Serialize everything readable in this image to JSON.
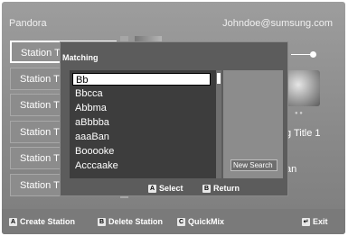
{
  "header": {
    "app_title": "Pandora",
    "account": "Johndoe@sumsung.com"
  },
  "stations": [
    {
      "label": "Station Title"
    },
    {
      "label": "Station Title"
    },
    {
      "label": "Station Title"
    },
    {
      "label": "Station Title"
    },
    {
      "label": "Station Title"
    },
    {
      "label": "Station Title"
    }
  ],
  "now_playing": {
    "song_title": "g Title 1",
    "artist": "an"
  },
  "popup": {
    "title": "Matching",
    "items": [
      "Bb",
      "Bbcca",
      "Abbma",
      "aBbbba",
      "aaaBan",
      "Booooke",
      "Acccaake"
    ],
    "selected_index": 0,
    "new_search_label": "New Search",
    "hints": {
      "select_key": "A",
      "select_label": "Select",
      "return_key": "B",
      "return_label": "Return"
    }
  },
  "bottom_bar": {
    "create": {
      "key": "A",
      "label": "Create Station"
    },
    "delete": {
      "key": "B",
      "label": "Delete Station"
    },
    "quickmix": {
      "key": "C",
      "label": "QuickMix"
    },
    "exit": {
      "key": "↵",
      "label": "Exit"
    }
  }
}
